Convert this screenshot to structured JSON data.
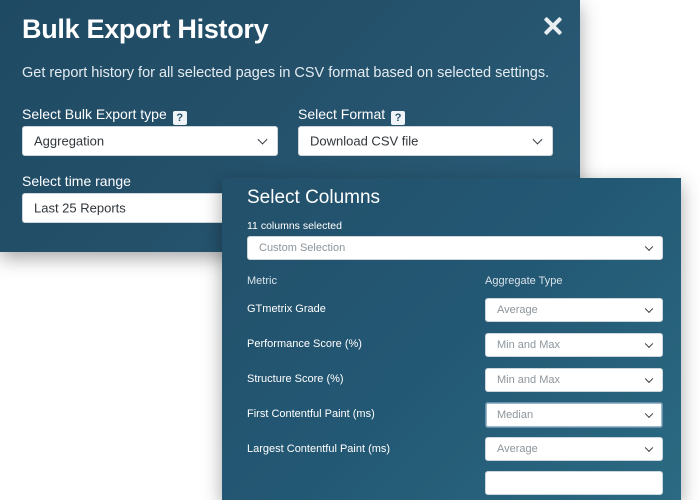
{
  "export_modal": {
    "title": "Bulk Export History",
    "close_icon": "close-icon",
    "subtitle": "Get report history for all selected pages in CSV format based on selected settings.",
    "type_label": "Select Bulk Export type",
    "type_value": "Aggregation",
    "format_label": "Select Format",
    "format_value": "Download CSV file",
    "range_label": "Select time range",
    "range_value": "Last 25 Reports",
    "help_glyph": "?"
  },
  "columns_panel": {
    "title": "Select Columns",
    "count_text": "11 columns selected",
    "selection_value": "Custom Selection",
    "header_metric": "Metric",
    "header_aggregate": "Aggregate Type",
    "rows": [
      {
        "metric": "GTmetrix Grade",
        "aggregate": "Average"
      },
      {
        "metric": "Performance Score (%)",
        "aggregate": "Min and Max"
      },
      {
        "metric": "Structure Score (%)",
        "aggregate": "Min and Max"
      },
      {
        "metric": "First Contentful Paint (ms)",
        "aggregate": "Median"
      },
      {
        "metric": "Largest Contentful Paint (ms)",
        "aggregate": "Average"
      }
    ]
  },
  "colors": {
    "panel_bg": "#24506a",
    "text": "#ffffff"
  }
}
